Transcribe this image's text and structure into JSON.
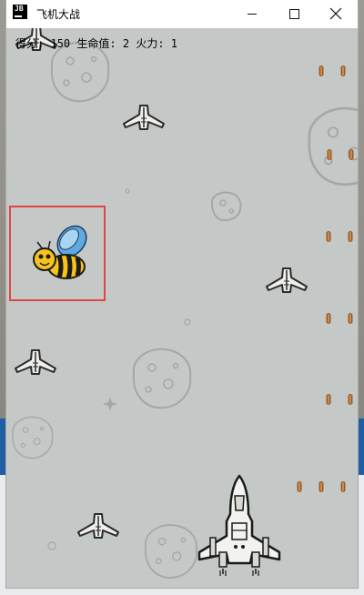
{
  "window": {
    "title": "飞机大战",
    "icon_text": "JB",
    "controls": [
      "minimize-icon",
      "maximize-icon",
      "close-icon"
    ]
  },
  "hud": {
    "score_label": "得分:",
    "score_value": "150",
    "life_label": "生命值:",
    "life_value": "2",
    "firepower_label": "火力:",
    "firepower_value": "1"
  },
  "sprites": {
    "hero": "hero-plane-icon",
    "enemy": "enemy-plane-icon",
    "bee": "bee-icon",
    "bullet": "enemy-bullet-icon",
    "rock": "asteroid-icon"
  },
  "colors": {
    "canvas_bg": "#c4c8c6",
    "highlight_box": "#e14444",
    "bullet": "#9a5a2a",
    "bee_yellow": "#f7c31a",
    "bee_wing": "#5fa8e0"
  }
}
